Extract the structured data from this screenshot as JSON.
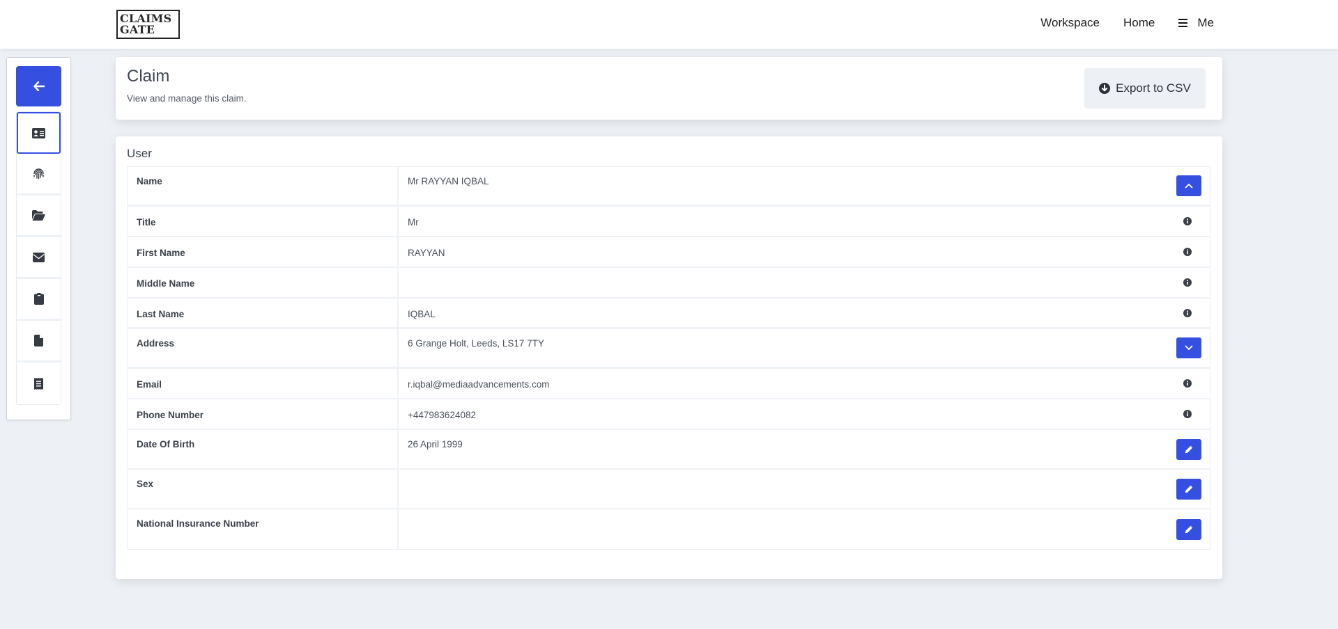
{
  "navbar": {
    "logo_line1": "CLAIMS",
    "logo_line2": "GATE",
    "links": [
      {
        "label": "Workspace"
      },
      {
        "label": "Home"
      },
      {
        "label": "Me",
        "icon": "hamburger-icon"
      }
    ]
  },
  "sidebar": {
    "back_icon": "arrow-left-icon",
    "items": [
      {
        "icon": "id-card-icon",
        "active": true
      },
      {
        "icon": "fingerprint-icon",
        "active": false
      },
      {
        "icon": "folder-open-icon",
        "active": false
      },
      {
        "icon": "envelope-icon",
        "active": false
      },
      {
        "icon": "clipboard-icon",
        "active": false
      },
      {
        "icon": "file-icon",
        "active": false
      },
      {
        "icon": "receipt-icon",
        "active": false
      }
    ]
  },
  "header": {
    "title": "Claim",
    "subtitle": "View and manage this claim.",
    "export_label": "Export to CSV",
    "export_icon": "circle-arrow-down-icon"
  },
  "user_section": {
    "title": "User",
    "rows": [
      {
        "label": "Name",
        "value": "Mr RAYYAN IQBAL",
        "action": "chevron-up-icon"
      },
      {
        "label": "Title",
        "value": "Mr",
        "action": "info-icon"
      },
      {
        "label": "First Name",
        "value": "RAYYAN",
        "action": "info-icon"
      },
      {
        "label": "Middle Name",
        "value": "",
        "action": "info-icon"
      },
      {
        "label": "Last Name",
        "value": "IQBAL",
        "action": "info-icon"
      },
      {
        "label": "Address",
        "value": "6 Grange Holt, Leeds, LS17 7TY",
        "action": "chevron-down-icon"
      },
      {
        "label": "Email",
        "value": "r.iqbal@mediaadvancements.com",
        "action": "info-icon"
      },
      {
        "label": "Phone Number",
        "value": "+447983624082",
        "action": "info-icon"
      },
      {
        "label": "Date Of Birth",
        "value": "26 April 1999",
        "action": "pencil-icon"
      },
      {
        "label": "Sex",
        "value": "",
        "action": "pencil-icon"
      },
      {
        "label": "National Insurance Number",
        "value": "",
        "action": "pencil-icon"
      }
    ]
  },
  "colors": {
    "accent": "#3550e0",
    "background": "#edf0f4",
    "text": "#3d4450"
  }
}
